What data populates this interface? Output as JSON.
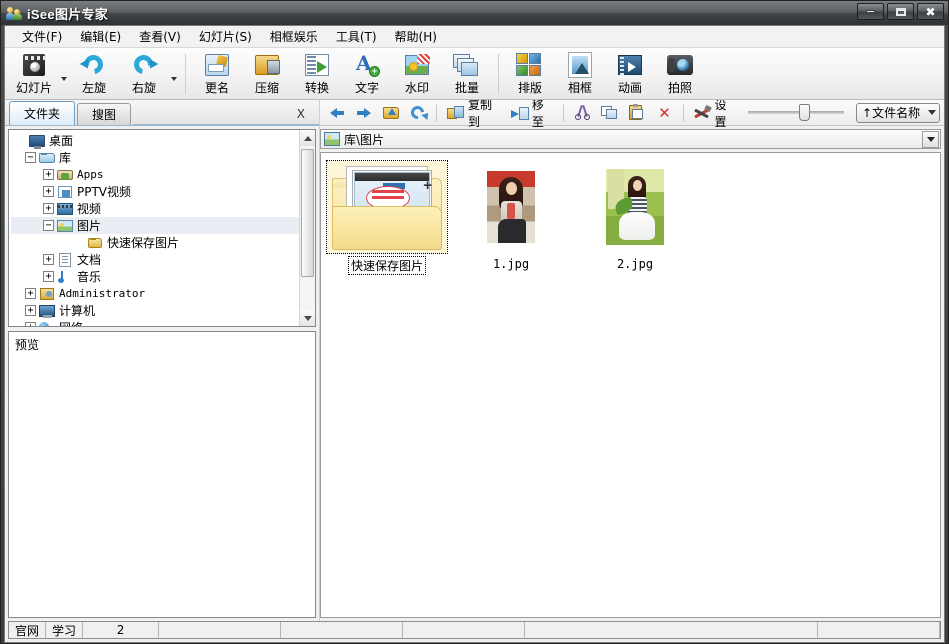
{
  "window": {
    "title": "iSee图片专家",
    "app_icon": "people-icon",
    "controls": {
      "minimize": "—",
      "maximize": "▢",
      "close": "✕"
    }
  },
  "menubar": {
    "items": [
      {
        "label": "文件(F)",
        "name": "menu-file"
      },
      {
        "label": "编辑(E)",
        "name": "menu-edit"
      },
      {
        "label": "查看(V)",
        "name": "menu-view"
      },
      {
        "label": "幻灯片(S)",
        "name": "menu-slideshow"
      },
      {
        "label": "相框娱乐",
        "name": "menu-frame-fun"
      },
      {
        "label": "工具(T)",
        "name": "menu-tools"
      },
      {
        "label": "帮助(H)",
        "name": "menu-help"
      }
    ]
  },
  "toolbar": {
    "buttons": [
      {
        "label": "幻灯片",
        "icon": "slideshow-icon",
        "dropdown": true
      },
      {
        "label": "左旋",
        "icon": "rotate-left-icon"
      },
      {
        "label": "右旋",
        "icon": "rotate-right-icon",
        "dropdown": true
      },
      {
        "label": "更名",
        "icon": "rename-icon"
      },
      {
        "label": "压缩",
        "icon": "compress-icon"
      },
      {
        "label": "转换",
        "icon": "convert-icon"
      },
      {
        "label": "文字",
        "icon": "add-text-icon"
      },
      {
        "label": "水印",
        "icon": "watermark-icon"
      },
      {
        "label": "批量",
        "icon": "batch-icon"
      },
      {
        "label": "排版",
        "icon": "layout-icon"
      },
      {
        "label": "相框",
        "icon": "photo-frame-icon"
      },
      {
        "label": "动画",
        "icon": "animation-icon"
      },
      {
        "label": "拍照",
        "icon": "camera-icon"
      }
    ]
  },
  "tabs": {
    "items": [
      {
        "label": "文件夹",
        "active": true,
        "name": "tab-folders"
      },
      {
        "label": "搜图",
        "active": false,
        "name": "tab-search-images"
      }
    ],
    "close_label": "X"
  },
  "file_toolbar": {
    "back": "back-arrow-icon",
    "forward": "forward-arrow-icon",
    "up": "up-folder-icon",
    "refresh": "refresh-icon",
    "copy_to_label": "复制到",
    "move_to_label": "移至",
    "cut": "cut-icon",
    "copy": "copy-icon",
    "paste": "paste-icon",
    "delete": "delete-icon",
    "settings_label": "设置",
    "sort_label": "↑文件名称"
  },
  "tree": {
    "nodes": [
      {
        "label": "桌面",
        "icon": "desktop-icon",
        "indent": 0,
        "expander": "",
        "selected": false,
        "mono": false
      },
      {
        "label": "库",
        "icon": "library-icon",
        "indent": 1,
        "expander": "−",
        "selected": false,
        "mono": false
      },
      {
        "label": "Apps",
        "icon": "apps-icon",
        "indent": 2,
        "expander": "+",
        "selected": false,
        "mono": true
      },
      {
        "label": "PPTV视频",
        "icon": "pptv-icon",
        "indent": 2,
        "expander": "+",
        "selected": false,
        "mono": false
      },
      {
        "label": "视频",
        "icon": "video-icon",
        "indent": 2,
        "expander": "+",
        "selected": false,
        "mono": false
      },
      {
        "label": "图片",
        "icon": "pictures-icon",
        "indent": 2,
        "expander": "−",
        "selected": true,
        "mono": false
      },
      {
        "label": "快速保存图片",
        "icon": "folder-icon",
        "indent": 3,
        "expander": "",
        "selected": false,
        "mono": false
      },
      {
        "label": "文档",
        "icon": "documents-icon",
        "indent": 2,
        "expander": "+",
        "selected": false,
        "mono": false
      },
      {
        "label": "音乐",
        "icon": "music-icon",
        "indent": 2,
        "expander": "+",
        "selected": false,
        "mono": false
      },
      {
        "label": "Administrator",
        "icon": "user-icon",
        "indent": 1,
        "expander": "+",
        "selected": false,
        "mono": true
      },
      {
        "label": "计算机",
        "icon": "computer-icon",
        "indent": 1,
        "expander": "+",
        "selected": false,
        "mono": false
      },
      {
        "label": "网络",
        "icon": "network-icon",
        "indent": 1,
        "expander": "+",
        "selected": false,
        "mono": false
      }
    ]
  },
  "preview": {
    "label": "预览"
  },
  "path": {
    "text": "库\\图片",
    "icon": "pictures-icon"
  },
  "files": {
    "items": [
      {
        "name": "快速保存图片",
        "type": "folder",
        "selected": true
      },
      {
        "name": "1.jpg",
        "type": "photo1",
        "selected": false
      },
      {
        "name": "2.jpg",
        "type": "photo2",
        "selected": false
      }
    ]
  },
  "statusbar": {
    "link1": "官网",
    "link2": "学习",
    "count": "2"
  }
}
